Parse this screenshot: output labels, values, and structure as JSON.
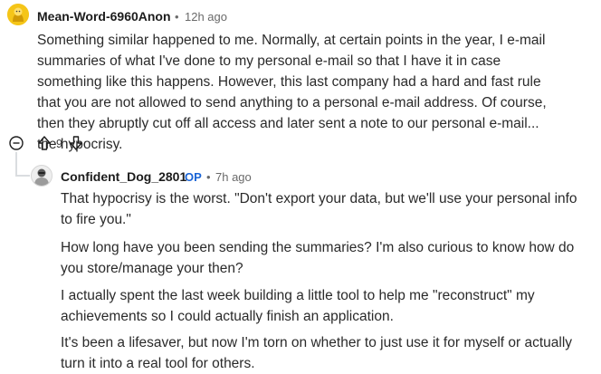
{
  "comment1": {
    "author": "Mean-Word-6960Anon",
    "separator": "•",
    "time": "12h ago",
    "text": "Something similar happened to me. Normally, at certain points in the year, I e-mail summaries of what I've done to my personal e-mail so that I have it in case something like this happens. However, this last company had a hard and fast rule that you are not allowed to send anything to a personal e-mail address. Of course, then they abruptly cut off all access and later sent a note to our personal e-mail... the hypocrisy.",
    "votes": "9"
  },
  "comment2": {
    "author": "Confident_Dog_2801",
    "badge": "OP",
    "separator": "•",
    "time": "7h ago",
    "paragraphs": [
      "That hypocrisy is the worst. \"Don't export your data, but we'll use your personal info to fire you.\"",
      "How long have you been sending the summaries? I'm also curious to know how do you store/manage your then?",
      "I actually spent the last week building a little tool to help me \"reconstruct\" my achievements so I could actually finish an application.",
      "It's been a lifesaver, but now I'm torn on whether to just use it for myself or actually turn it into a real tool for others."
    ]
  },
  "colors": {
    "accent": "#1a64d6",
    "meta": "#6a6a6a",
    "avatar1": "#f5c518"
  },
  "icons": [
    "avatar-icon",
    "collapse-icon",
    "upvote-icon",
    "downvote-icon"
  ]
}
